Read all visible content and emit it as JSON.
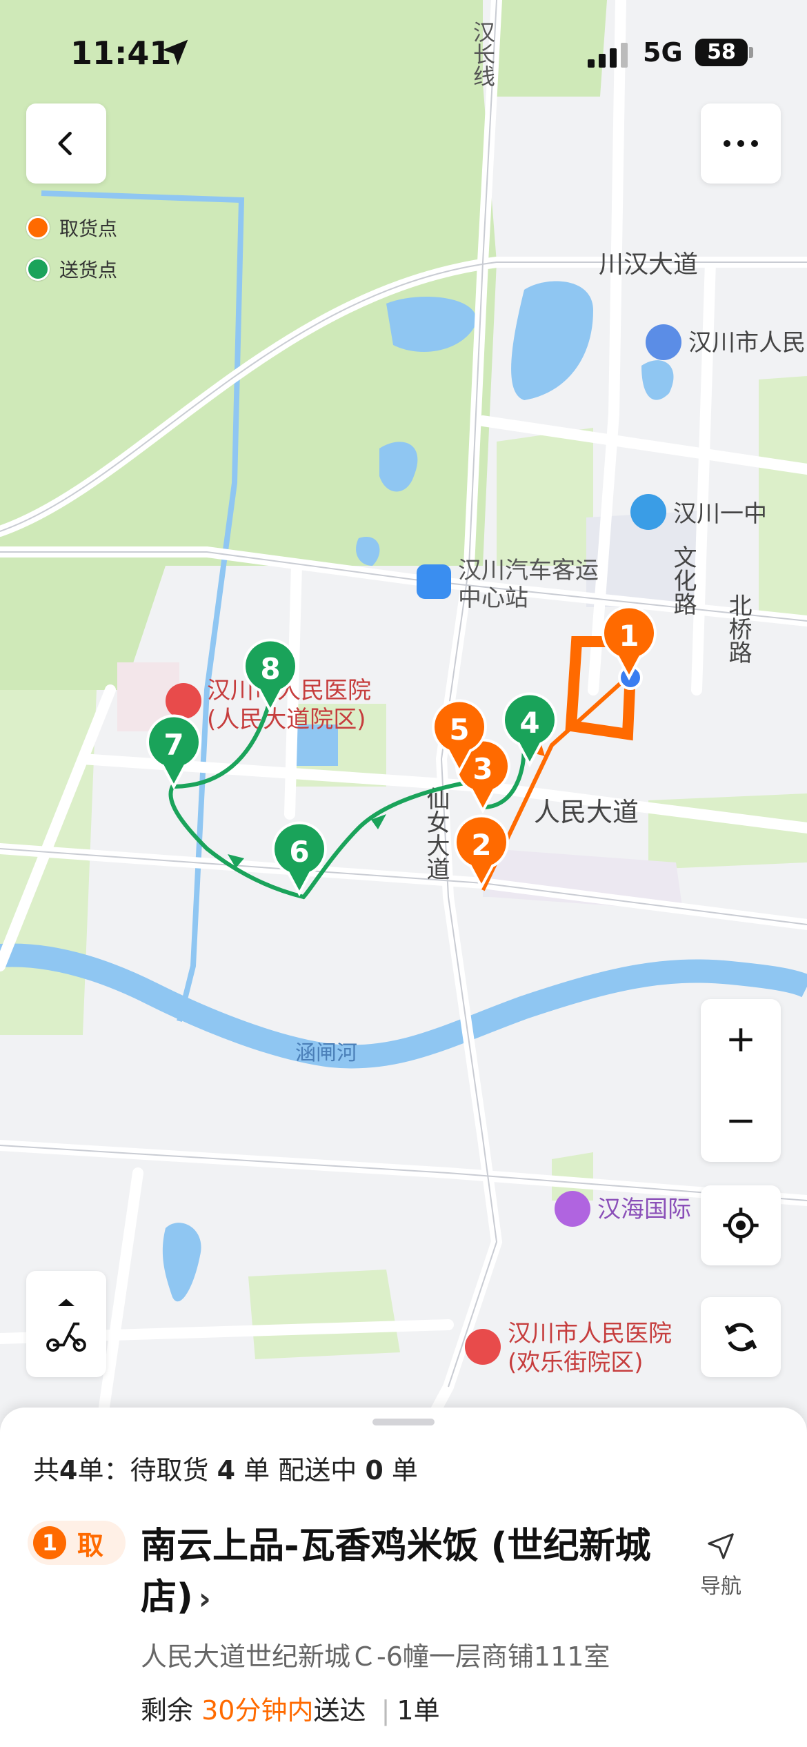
{
  "status_bar": {
    "time": "11:41",
    "network": "5G",
    "battery": "58"
  },
  "legend": {
    "pickup_label": "取货点",
    "delivery_label": "送货点",
    "pickup_color": "#ff6a00",
    "delivery_color": "#1aa35a"
  },
  "map": {
    "labels": {
      "hanchang_line": "汉长线",
      "chuanhan_avenue": "川汉大道",
      "people_gov": "汉川市人民",
      "hanchuan_no1": "汉川一中",
      "wenhua_road": "文化路",
      "beiqiao_road": "北桥路",
      "bus_station_1": "汉川汽车客运",
      "bus_station_2": "中心站",
      "hospital_1a": "汉川市人民医院",
      "hospital_1b": "(人民大道院区)",
      "renmin_avenue": "人民大道",
      "xiannv_avenue": "仙女大道",
      "hanzha_river": "涵闸河",
      "hanhai_intl": "汉海国际",
      "hospital_2a": "汉川市人民医院",
      "hospital_2b": "(欢乐街院区)"
    },
    "markers": [
      {
        "num": "1",
        "type": "pickup"
      },
      {
        "num": "2",
        "type": "pickup"
      },
      {
        "num": "3",
        "type": "pickup"
      },
      {
        "num": "4",
        "type": "delivery"
      },
      {
        "num": "5",
        "type": "pickup"
      },
      {
        "num": "6",
        "type": "delivery"
      },
      {
        "num": "7",
        "type": "delivery"
      },
      {
        "num": "8",
        "type": "delivery"
      }
    ]
  },
  "controls": {
    "back_icon": "chevron-left-icon",
    "more_icon": "more-icon",
    "zoom_in_icon": "plus-icon",
    "zoom_out_icon": "minus-icon",
    "locate_icon": "crosshair-icon",
    "refresh_icon": "refresh-icon",
    "vehicle_icon": "scooter-icon"
  },
  "sheet": {
    "summary_prefix": "共",
    "summary_count": "4",
    "summary_mid": "单：待取货",
    "summary_pending": "4",
    "summary_mid2": "单  配送中",
    "summary_delivering": "0",
    "summary_suffix": "单",
    "order": {
      "index": "1",
      "type_label": "取",
      "store_name": "南云上品-瓦香鸡米饭 (世纪新城店)",
      "chevron": "›",
      "nav_label": "导航",
      "address": "人民大道世纪新城Ｃ-6幢一层商铺111室",
      "remain_prefix": "剩余",
      "remain_time": "30分钟内",
      "remain_suffix": "送达",
      "separator": "|",
      "quantity": "1单"
    }
  }
}
